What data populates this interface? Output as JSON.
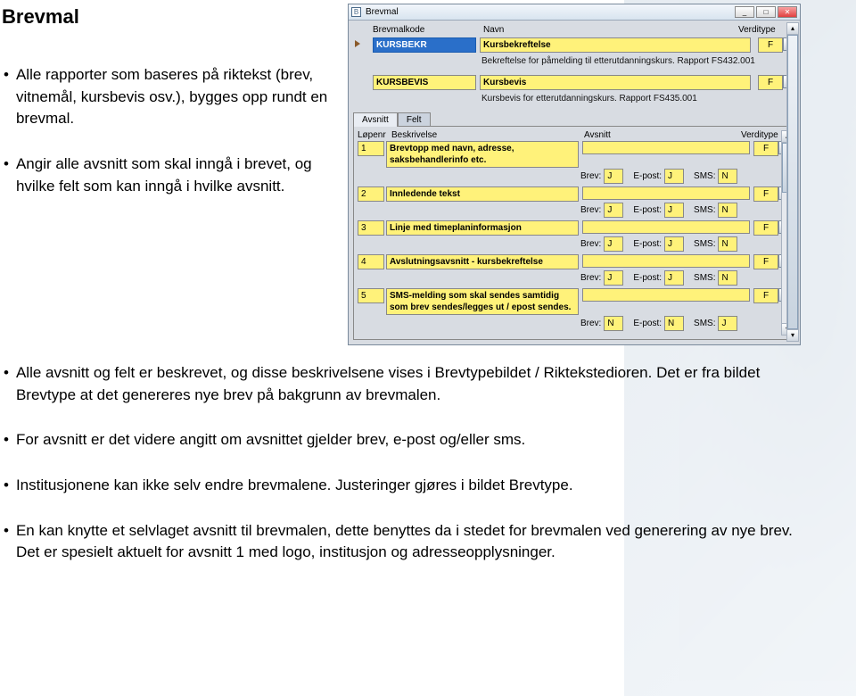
{
  "title": "Brevmal",
  "bullets_top": [
    "Alle rapporter som baseres på riktekst (brev, vitnemål, kursbevis osv.), bygges opp rundt en brevmal.",
    "Angir alle avsnitt som skal inngå i brevet, og hvilke felt som kan inngå i hvilke avsnitt."
  ],
  "bullets_bottom": [
    "Alle avsnitt og felt er beskrevet, og disse beskrivelsene vises i Brevtypebildet / Riktekstedioren. Det er fra bildet Brevtype at det genereres nye brev på bakgrunn av brevmalen.",
    "For avsnitt er det videre angitt om avsnittet gjelder brev, e-post og/eller sms.",
    "Institusjonene kan ikke selv endre brevmalene. Justeringer gjøres i bildet Brevtype.",
    "En kan knytte et selvlaget avsnitt til brevmalen, dette benyttes da i stedet for brevmalen ved generering av nye brev. Det er spesielt aktuelt for avsnitt 1 med logo, institusjon og adresseopplysninger."
  ],
  "dialog": {
    "title": "Brevmal",
    "columns": {
      "kode": "Brevmalkode",
      "navn": "Navn",
      "verdi": "Verditype"
    },
    "entries": [
      {
        "kode": "KURSBEKR",
        "navn": "Kursbekreftelse",
        "desc": "Bekreftelse for påmelding til etterutdanningskurs. Rapport FS432.001",
        "verdi": "F",
        "selected": true
      },
      {
        "kode": "KURSBEVIS",
        "navn": "Kursbevis",
        "desc": "Kursbevis for etterutdanningskurs. Rapport FS435.001",
        "verdi": "F",
        "selected": false
      }
    ],
    "tabs": {
      "active": "Avsnitt",
      "other": "Felt"
    },
    "subcolumns": {
      "lopenr": "Løpenr",
      "beskrivelse": "Beskrivelse",
      "avsnitt": "Avsnitt",
      "verditype": "Verditype"
    },
    "channels": {
      "brev": "Brev:",
      "epost": "E-post:",
      "sms": "SMS:"
    },
    "avsnitt": [
      {
        "nr": "1",
        "besk": "Brevtopp med navn, adresse, saksbehandlerinfo etc.",
        "verdi": "F",
        "brev": "J",
        "epost": "J",
        "sms": "N"
      },
      {
        "nr": "2",
        "besk": "Innledende tekst",
        "verdi": "F",
        "brev": "J",
        "epost": "J",
        "sms": "N"
      },
      {
        "nr": "3",
        "besk": "Linje med timeplaninformasjon",
        "verdi": "F",
        "brev": "J",
        "epost": "J",
        "sms": "N"
      },
      {
        "nr": "4",
        "besk": "Avslutningsavsnitt - kursbekreftelse",
        "verdi": "F",
        "brev": "J",
        "epost": "J",
        "sms": "N"
      },
      {
        "nr": "5",
        "besk": "SMS-melding som skal sendes samtidig som brev sendes/legges ut / epost sendes.",
        "verdi": "F",
        "brev": "N",
        "epost": "N",
        "sms": "J"
      }
    ],
    "winbtns": {
      "min": "_",
      "max": "□",
      "close": "✕"
    }
  }
}
